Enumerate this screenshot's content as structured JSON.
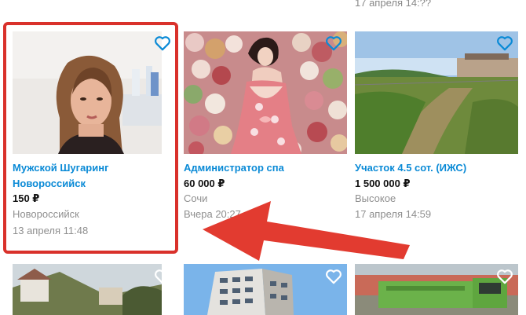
{
  "top_fragment": "17 апреля 14:??",
  "currency": "₽",
  "listings": [
    {
      "title_line1": "Мужской Шугаринг",
      "title_line2": "Новороссийск",
      "price": "150 ₽",
      "location": "Новороссийск",
      "date": "13 апреля 11:48",
      "favorite_icon": "heart-icon",
      "image": "woman-portrait-photo"
    },
    {
      "title_line1": "Администратор спа",
      "title_line2": "",
      "price": "60 000 ₽",
      "location": "Сочи",
      "date": "Вчера 20:27",
      "favorite_icon": "heart-icon",
      "image": "woman-in-floral-dress-photo"
    },
    {
      "title_line1": "Участок 4.5 сот. (ИЖС)",
      "title_line2": "",
      "price": "1 500 000 ₽",
      "location": "Высокое",
      "date": "17 апреля 14:59",
      "favorite_icon": "heart-icon",
      "image": "land-plot-photo"
    }
  ],
  "next_row": [
    {
      "favorite_icon": "heart-icon",
      "image": "hillside-houses-photo"
    },
    {
      "favorite_icon": "heart-icon",
      "image": "apartment-building-photo"
    },
    {
      "favorite_icon": "heart-icon",
      "image": "green-truck-photo"
    }
  ],
  "annotation": {
    "highlight_color": "#d9312b",
    "arrow_color": "#e23b30"
  },
  "colors": {
    "link": "#0a8ad6",
    "meta": "#8f8f8f",
    "price": "#111111"
  }
}
